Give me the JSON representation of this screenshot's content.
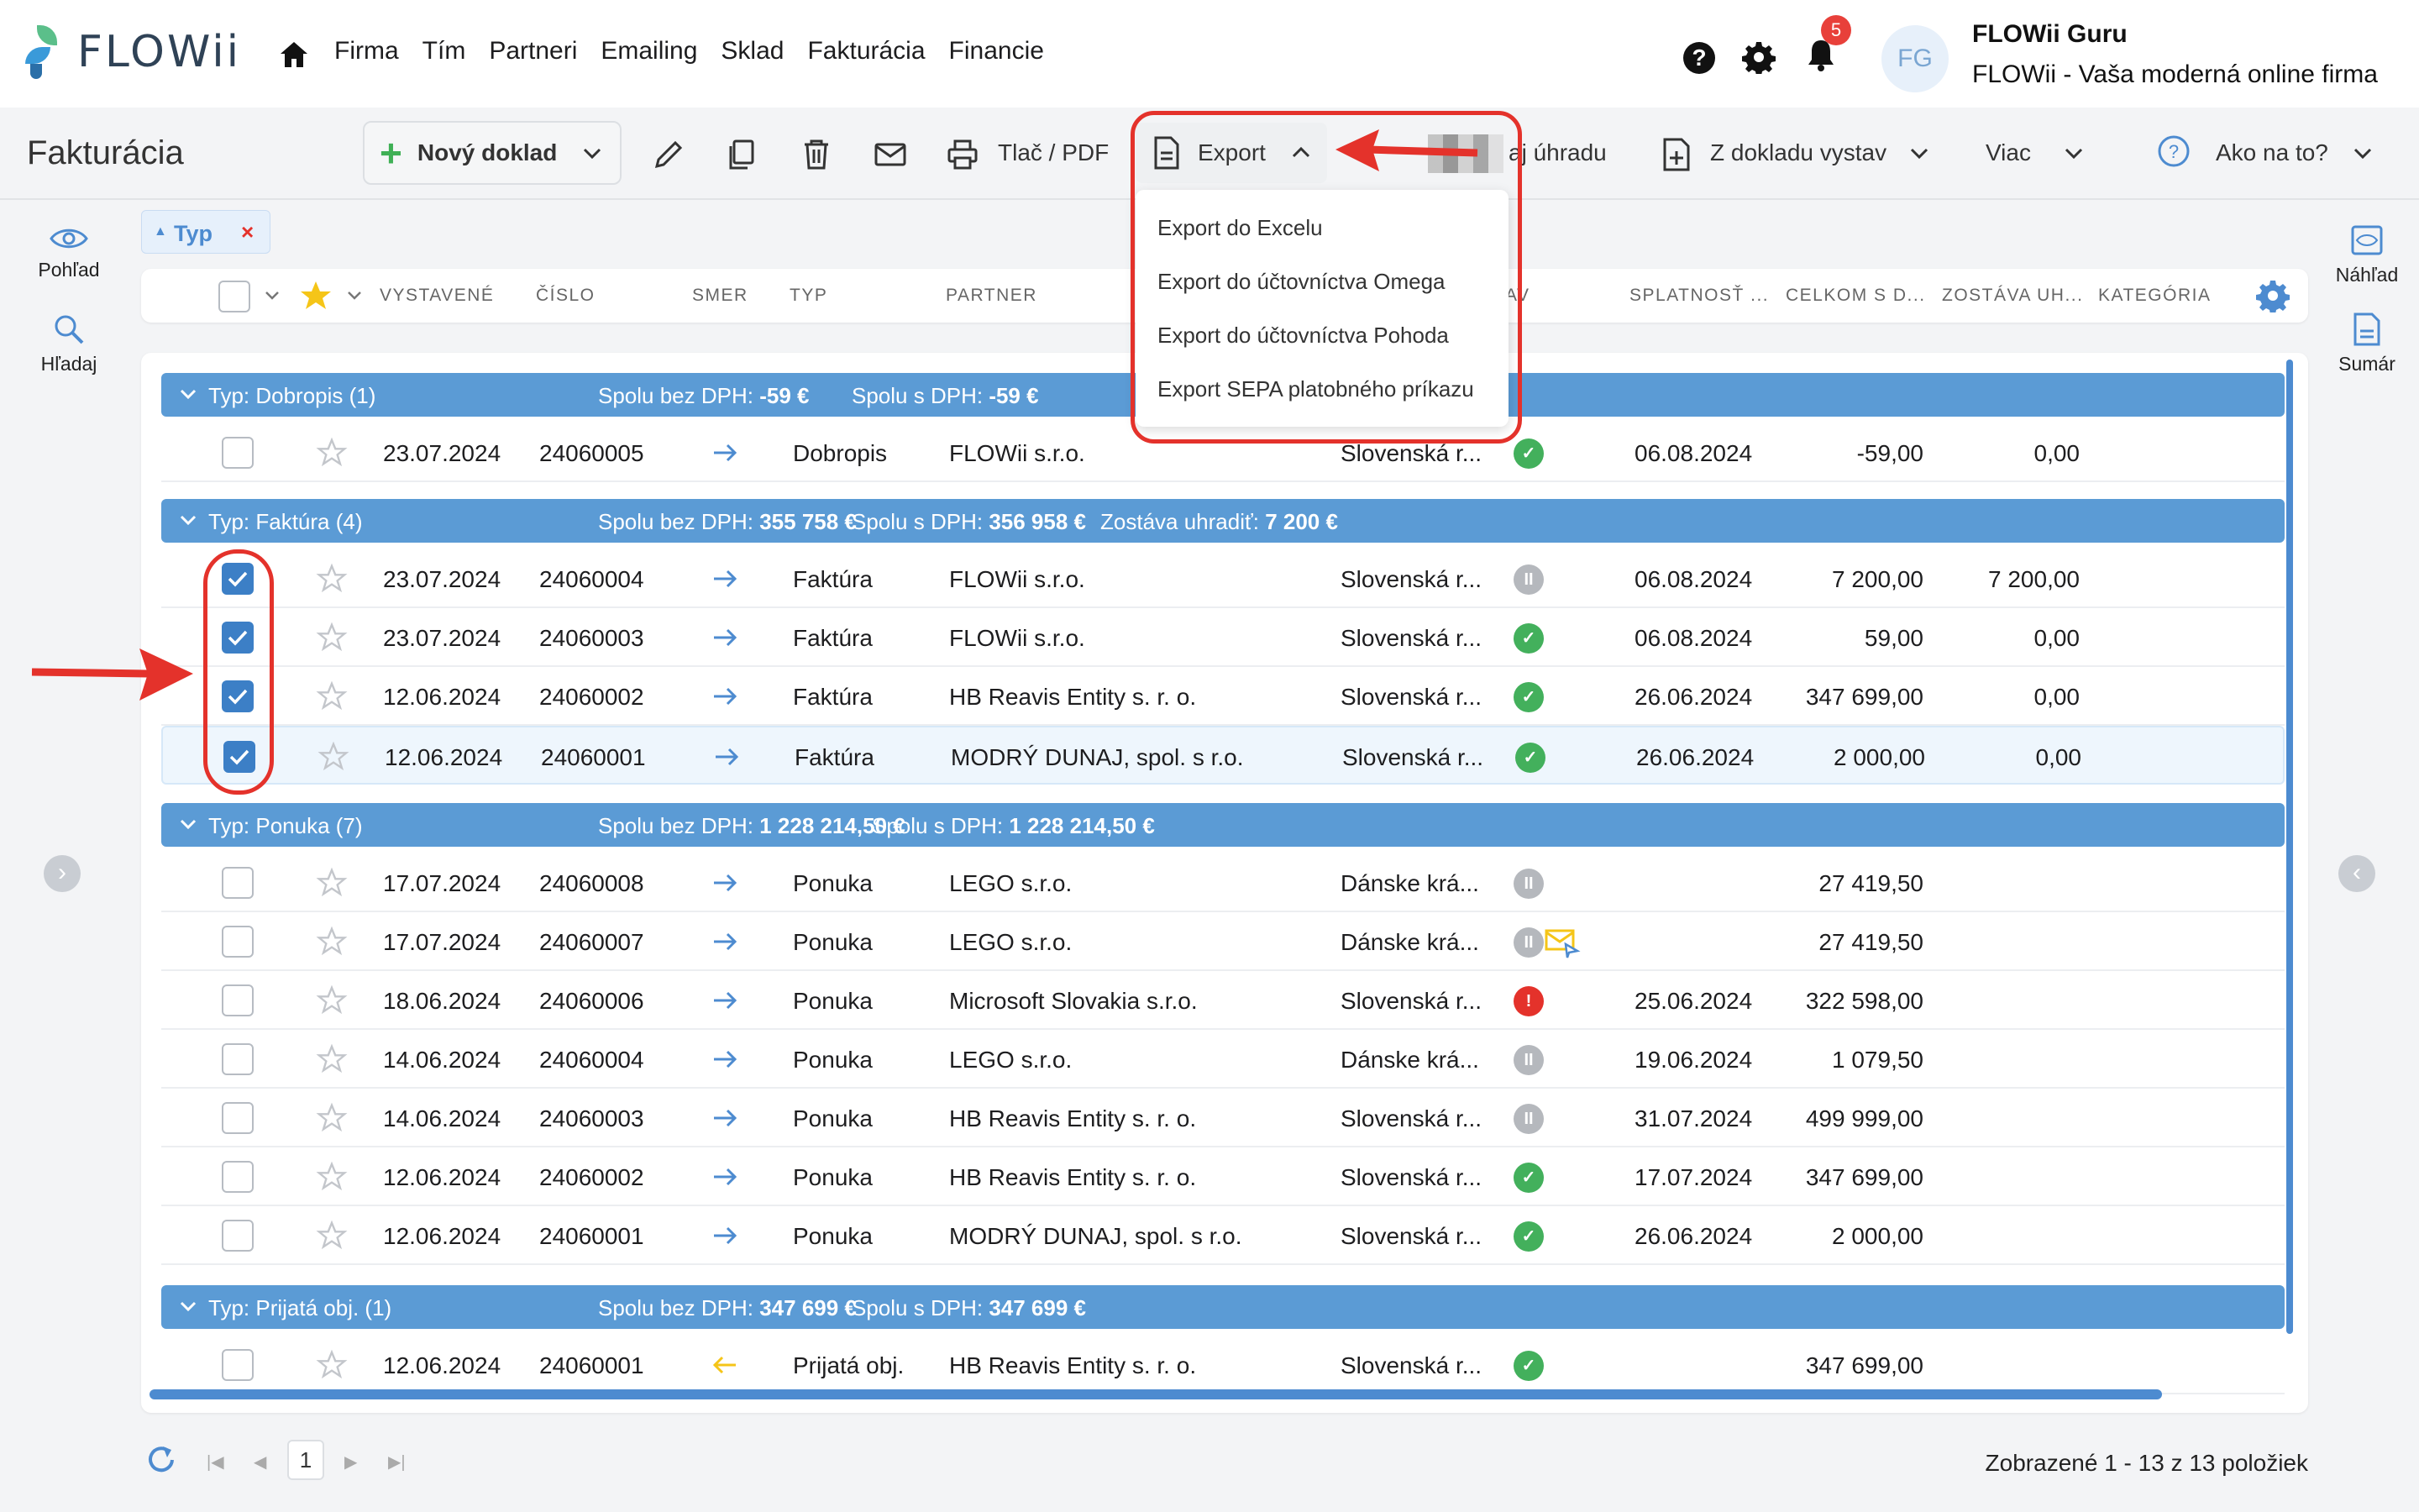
{
  "app": {
    "logo_text": "FLOWii"
  },
  "nav": [
    "Firma",
    "Tím",
    "Partneri",
    "Emailing",
    "Sklad",
    "Fakturácia",
    "Financie"
  ],
  "user": {
    "initials": "FG",
    "name": "FLOWii Guru",
    "company": "FLOWii - Vaša moderná online firma",
    "notifications": "5"
  },
  "toolbar": {
    "title": "Fakturácia",
    "new_doc": "Nový doklad",
    "print": "Tlač / PDF",
    "export": "Export",
    "pay_partial": "aj úhradu",
    "from_doc": "Z dokladu vystav",
    "more": "Viac",
    "help": "Ako na to?"
  },
  "export_menu": [
    "Export do Excelu",
    "Export do účtovníctva Omega",
    "Export do účtovníctva Pohoda",
    "Export SEPA platobného príkazu"
  ],
  "side_left": {
    "view": "Pohľad",
    "search": "Hľadaj"
  },
  "side_right": {
    "preview": "Náhľad",
    "summary": "Sumár"
  },
  "filter_chip": {
    "label": "Typ",
    "remove": "×"
  },
  "columns": {
    "issued": "VYSTAVENÉ",
    "number": "ČÍSLO",
    "direction": "SMER",
    "type": "TYP",
    "partner": "PARTNER",
    "state_partial": "AV",
    "due": "SPLATNOSŤ ...",
    "total": "CELKOM S D...",
    "remaining": "ZOSTÁVA UH...",
    "category": "KATEGÓRIA"
  },
  "groups": [
    {
      "label": "Typ: Dobropis (1)",
      "s1_label": "Spolu bez DPH:",
      "s1": "-59 €",
      "s2_label": "Spolu s DPH:",
      "s2": "-59 €",
      "s3_label": "",
      "s3": ""
    },
    {
      "label": "Typ: Faktúra (4)",
      "s1_label": "Spolu bez DPH:",
      "s1": "355 758 €",
      "s2_label": "Spolu s DPH:",
      "s2": "356 958 €",
      "s3_label": "Zostáva uhradiť:",
      "s3": "7 200 €"
    },
    {
      "label": "Typ: Ponuka (7)",
      "s1_label": "Spolu bez DPH:",
      "s1": "1 228 214,50 €",
      "s2_label": "Spolu s DPH:",
      "s2": "1 228 214,50 €",
      "s3_label": "",
      "s3": ""
    },
    {
      "label": "Typ: Prijatá obj. (1)",
      "s1_label": "Spolu bez DPH:",
      "s1": "347 699 €",
      "s2_label": "Spolu s DPH:",
      "s2": "347 699 €",
      "s3_label": "",
      "s3": ""
    }
  ],
  "rows": [
    {
      "date": "23.07.2024",
      "num": "24060005",
      "type": "Dobropis",
      "partner": "FLOWii s.r.o.",
      "country": "Slovenská r...",
      "status": "ok",
      "due": "06.08.2024",
      "total": "-59,00",
      "remaining": "0,00",
      "checked": false,
      "incoming": false
    },
    {
      "date": "23.07.2024",
      "num": "24060004",
      "type": "Faktúra",
      "partner": "FLOWii s.r.o.",
      "country": "Slovenská r...",
      "status": "pending",
      "due": "06.08.2024",
      "total": "7 200,00",
      "remaining": "7 200,00",
      "checked": true,
      "incoming": false
    },
    {
      "date": "23.07.2024",
      "num": "24060003",
      "type": "Faktúra",
      "partner": "FLOWii s.r.o.",
      "country": "Slovenská r...",
      "status": "ok",
      "due": "06.08.2024",
      "total": "59,00",
      "remaining": "0,00",
      "checked": true,
      "incoming": false
    },
    {
      "date": "12.06.2024",
      "num": "24060002",
      "type": "Faktúra",
      "partner": "HB Reavis Entity s. r. o.",
      "country": "Slovenská r...",
      "status": "ok",
      "due": "26.06.2024",
      "total": "347 699,00",
      "remaining": "0,00",
      "checked": true,
      "incoming": false
    },
    {
      "date": "12.06.2024",
      "num": "24060001",
      "type": "Faktúra",
      "partner": "MODRÝ DUNAJ, spol. s r.o.",
      "country": "Slovenská r...",
      "status": "ok",
      "due": "26.06.2024",
      "total": "2 000,00",
      "remaining": "0,00",
      "checked": true,
      "incoming": false
    },
    {
      "date": "17.07.2024",
      "num": "24060008",
      "type": "Ponuka",
      "partner": "LEGO s.r.o.",
      "country": "Dánske krá...",
      "status": "pending",
      "due": "",
      "total": "27 419,50",
      "remaining": "",
      "checked": false,
      "incoming": false
    },
    {
      "date": "17.07.2024",
      "num": "24060007",
      "type": "Ponuka",
      "partner": "LEGO s.r.o.",
      "country": "Dánske krá...",
      "status": "pending",
      "due": "",
      "total": "27 419,50",
      "remaining": "",
      "checked": false,
      "incoming": false
    },
    {
      "date": "18.06.2024",
      "num": "24060006",
      "type": "Ponuka",
      "partner": "Microsoft Slovakia s.r.o.",
      "country": "Slovenská r...",
      "status": "err",
      "due": "25.06.2024",
      "total": "322 598,00",
      "remaining": "",
      "checked": false,
      "incoming": false
    },
    {
      "date": "14.06.2024",
      "num": "24060004",
      "type": "Ponuka",
      "partner": "LEGO s.r.o.",
      "country": "Dánske krá...",
      "status": "pending",
      "due": "19.06.2024",
      "total": "1 079,50",
      "remaining": "",
      "checked": false,
      "incoming": false
    },
    {
      "date": "14.06.2024",
      "num": "24060003",
      "type": "Ponuka",
      "partner": "HB Reavis Entity s. r. o.",
      "country": "Slovenská r...",
      "status": "pending",
      "due": "31.07.2024",
      "total": "499 999,00",
      "remaining": "",
      "checked": false,
      "incoming": false
    },
    {
      "date": "12.06.2024",
      "num": "24060002",
      "type": "Ponuka",
      "partner": "HB Reavis Entity s. r. o.",
      "country": "Slovenská r...",
      "status": "ok",
      "due": "17.07.2024",
      "total": "347 699,00",
      "remaining": "",
      "checked": false,
      "incoming": false
    },
    {
      "date": "12.06.2024",
      "num": "24060001",
      "type": "Ponuka",
      "partner": "MODRÝ DUNAJ, spol. s r.o.",
      "country": "Slovenská r...",
      "status": "ok",
      "due": "26.06.2024",
      "total": "2 000,00",
      "remaining": "",
      "checked": false,
      "incoming": false
    },
    {
      "date": "12.06.2024",
      "num": "24060001",
      "type": "Prijatá obj.",
      "partner": "HB Reavis Entity s. r. o.",
      "country": "Slovenská r...",
      "status": "ok",
      "due": "",
      "total": "347 699,00",
      "remaining": "",
      "checked": false,
      "incoming": true
    }
  ],
  "pager": {
    "page": "1",
    "info": "Zobrazené 1 - 13 z 13 položiek"
  },
  "colors": {
    "accent": "#5b9bd5",
    "ok": "#43b05c",
    "error": "#e4322b",
    "highlight": "#e4322b"
  }
}
